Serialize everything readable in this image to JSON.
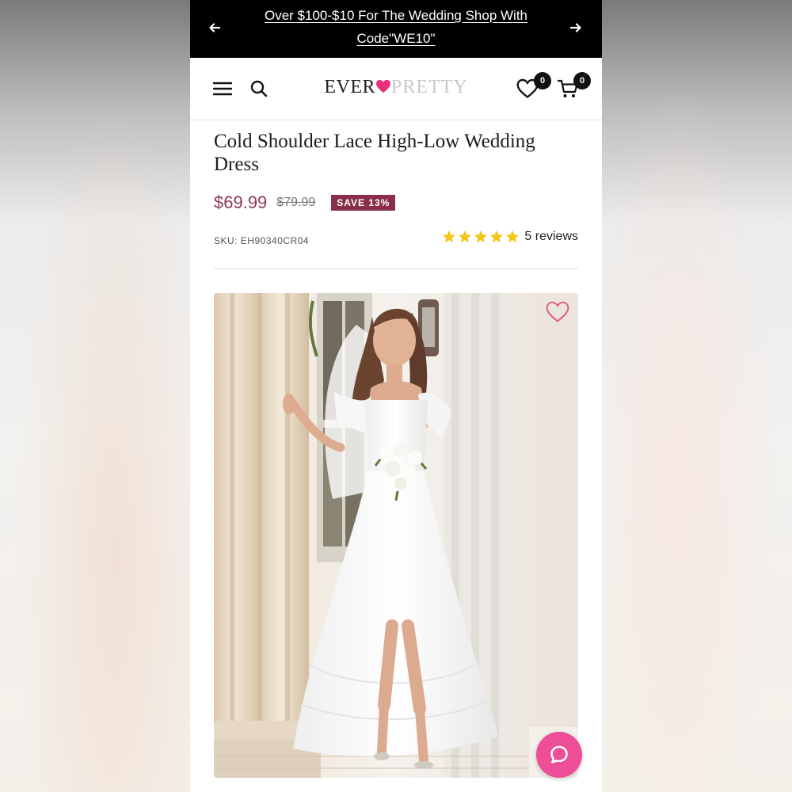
{
  "announcement": {
    "text": "Over $100-$10 For The Wedding Shop With Code\"WE10\""
  },
  "header": {
    "logo_left": "EVER",
    "logo_right": "PRETTY",
    "wishlist_count": "0",
    "cart_count": "0"
  },
  "product": {
    "title": "Cold Shoulder Lace High-Low Wedding Dress",
    "price": "$69.99",
    "original_price": "$79.99",
    "save_badge": "SAVE 13%",
    "sku": "SKU: EH90340CR04",
    "rating": 5,
    "reviews_text": "5 reviews"
  },
  "icons": {
    "prev": "arrow-left-icon",
    "next": "arrow-right-icon",
    "menu": "hamburger-menu-icon",
    "search": "search-icon",
    "wishlist": "heart-icon",
    "cart": "cart-icon",
    "favorite": "heart-outline-icon",
    "chat": "chat-bubble-icon",
    "star": "star-icon"
  },
  "colors": {
    "price": "#8d3a54",
    "save_badge_bg": "#8a2f4a",
    "logo_heart": "#ea2f7a",
    "star": "#f5c518",
    "chat_button": "#ee4d98",
    "favorite_heart": "#e0607e"
  }
}
